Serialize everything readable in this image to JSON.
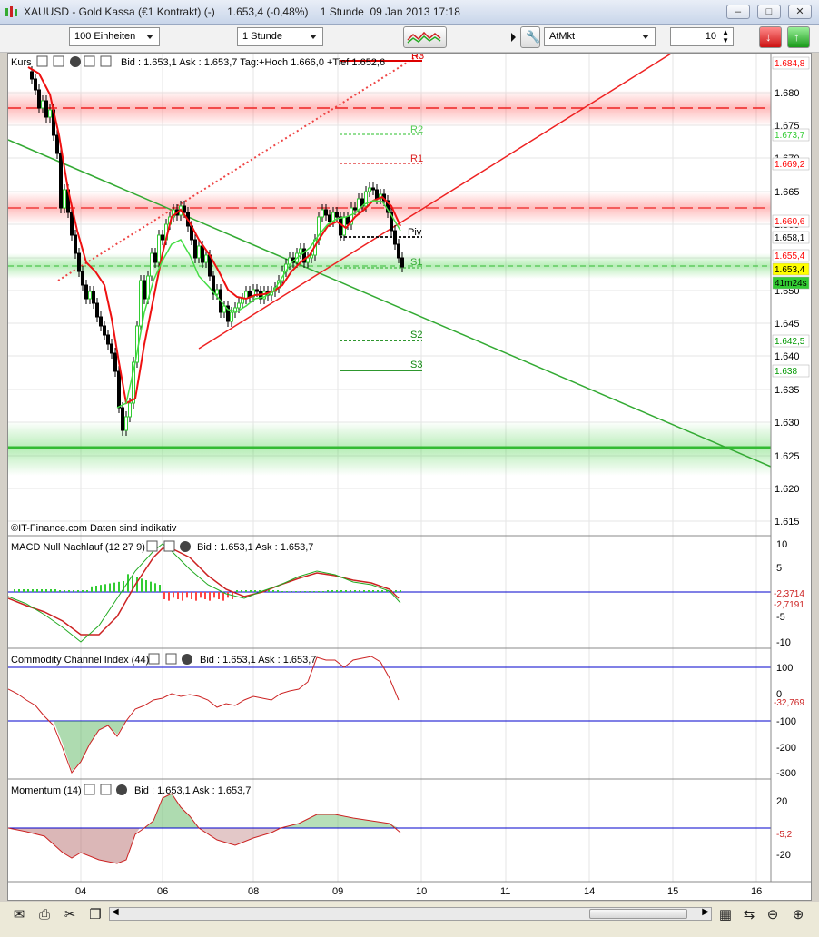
{
  "window": {
    "title": "XAUUSD - Gold Kassa (€1 Kontrakt) (-)    1.653,4 (-0,48%)    1 Stunde  09 Jan 2013 17:18",
    "buttons": {
      "minimize": "▭",
      "maximize": "□",
      "close": "✕"
    }
  },
  "toolbar": {
    "units_value": "100 Einheiten",
    "interval_value": "1 Stunde",
    "order_type_value": "AtMkt",
    "quantity_value": "10"
  },
  "main_panel": {
    "header": "Kurs",
    "quote": "Bid : 1.653,1  Ask : 1.653,7  Tag:+Hoch 1.666,0 +Tief 1.652,6",
    "watermark": "©IT-Finance.com  Daten sind indikativ",
    "y_ticks": [
      "1.680",
      "1.675",
      "1.670",
      "1.665",
      "1.660",
      "1.655",
      "1.650",
      "1.645",
      "1.640",
      "1.635",
      "1.630",
      "1.625",
      "1.620",
      "1.615"
    ],
    "price_tags": [
      {
        "text": "1.684,8",
        "color": "#ff0000",
        "bg": "#ffffff"
      },
      {
        "text": "1.673,7",
        "color": "#33cc33",
        "bg": "#ffffff"
      },
      {
        "text": "1.669,2",
        "color": "#ff0000",
        "bg": "#ffffff"
      },
      {
        "text": "1.660,6",
        "color": "#ff0000",
        "bg": "#ffffff"
      },
      {
        "text": "1.658,1",
        "color": "#000000",
        "bg": "#ffffff"
      },
      {
        "text": "1.655,4",
        "color": "#ff0000",
        "bg": "#ffffff"
      },
      {
        "text": "1.653,4",
        "color": "#000000",
        "bg": "#ffff00"
      },
      {
        "text": "41m24s",
        "color": "#000000",
        "bg": "#33cc33"
      },
      {
        "text": "1.642,5",
        "color": "#009900",
        "bg": "#ffffff"
      },
      {
        "text": "1.638",
        "color": "#009900",
        "bg": "#ffffff"
      }
    ],
    "pivot_labels": [
      "R3",
      "R2",
      "R1",
      "Piv",
      "S1",
      "S2",
      "S3"
    ]
  },
  "macd_panel": {
    "header": "MACD Null Nachlauf (12 27 9)",
    "quote": "Bid : 1.653,1  Ask : 1.653,7",
    "y_ticks": [
      "10",
      "5",
      "-5",
      "-10"
    ],
    "value_tags": [
      "-2,3714",
      "-2,7191"
    ]
  },
  "cci_panel": {
    "header": "Commodity Channel Index (44)",
    "quote": "Bid : 1.653,1  Ask : 1.653,7",
    "y_ticks": [
      "100",
      "0",
      "-100",
      "-200",
      "-300"
    ],
    "value_tag": "-32,769"
  },
  "momentum_panel": {
    "header": "Momentum (14)",
    "quote": "Bid : 1.653,1  Ask : 1.653,7",
    "y_ticks": [
      "20",
      "-20"
    ],
    "value_tag": "-5,2"
  },
  "x_axis": {
    "ticks": [
      "04",
      "06",
      "08",
      "09",
      "10",
      "11",
      "14",
      "15",
      "16"
    ]
  },
  "colors": {
    "bull": "#33cc33",
    "bear": "#ff0000",
    "support": "#33bb33",
    "resist": "#ff3333"
  },
  "icons": [
    "mail-icon",
    "printer-icon",
    "scissors-icon",
    "copy-icon",
    "zoom-in-icon",
    "zoom-out-icon",
    "fit-icon"
  ]
}
